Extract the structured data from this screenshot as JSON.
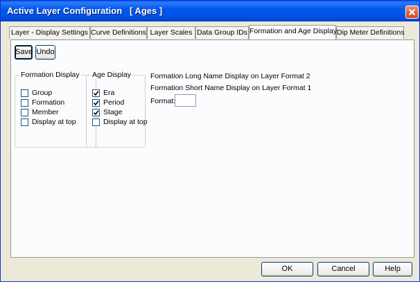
{
  "window": {
    "title": "Active Layer Configuration   [ Ages ]"
  },
  "tabs": [
    {
      "label": "Layer - Display Settings",
      "active": false
    },
    {
      "label": "Curve Definitions",
      "active": false
    },
    {
      "label": "Layer Scales",
      "active": false
    },
    {
      "label": "Data Group IDs",
      "active": false
    },
    {
      "label": "Formation and Age Display",
      "active": true
    },
    {
      "label": "Dip Meter Definitions",
      "active": false
    }
  ],
  "toolbar": {
    "save_label": "Save",
    "undo_label": "Undo"
  },
  "formation_display": {
    "legend": "Formation Display",
    "items": [
      {
        "label": "Group",
        "checked": false
      },
      {
        "label": "Formation",
        "checked": false
      },
      {
        "label": "Member",
        "checked": false
      },
      {
        "label": "Display at top",
        "checked": false
      }
    ]
  },
  "age_display": {
    "legend": "Age Display",
    "items": [
      {
        "label": "Era",
        "checked": true
      },
      {
        "label": "Period",
        "checked": true
      },
      {
        "label": "Stage",
        "checked": true
      },
      {
        "label": "Display at top",
        "checked": false
      }
    ]
  },
  "info": {
    "long_name": "Formation Long Name Display on Layer Format 2",
    "short_name": "Formation Short Name Display on Layer Format 1",
    "format_label": "Format:",
    "format_value": ""
  },
  "footer": {
    "ok_label": "OK",
    "cancel_label": "Cancel",
    "help_label": "Help"
  },
  "colors": {
    "titlebar": "#0058ee",
    "close_button": "#d1431f",
    "dialog_background": "#ece9d8",
    "panel_background": "#fcfcfe"
  }
}
